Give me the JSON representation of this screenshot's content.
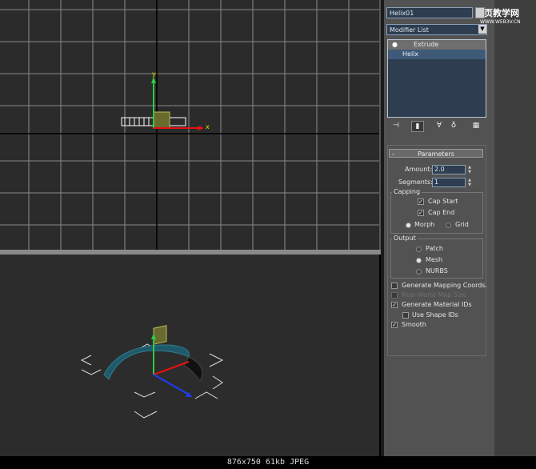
{
  "object_name": "Helix01",
  "modifier_list_label": "Modifier List",
  "stack_items": [
    "Extrude",
    "Helix"
  ],
  "parameters_title": "Parameters",
  "amount_label": "Amount:",
  "amount_value": "2.0",
  "segments_label": "Segments:",
  "segments_value": "1",
  "capping_title": "Capping",
  "cap_start_label": "Cap Start",
  "cap_end_label": "Cap End",
  "morph_label": "Morph",
  "grid_label": "Grid",
  "output_title": "Output",
  "patch_label": "Patch",
  "mesh_label": "Mesh",
  "nurbs_label": "NURBS",
  "gen_mapping_label": "Generate Mapping Coords.",
  "real_world_label": "Real-World Map Size",
  "gen_material_label": "Generate Material IDs",
  "use_shape_label": "Use Shape IDs",
  "smooth_label": "Smooth",
  "watermark_title": "网页教学网",
  "watermark_url": "WWW.WEB3V.CN",
  "axis_x": "x",
  "axis_y": "y",
  "status_text": "876x750  61kb  JPEG",
  "checkboxes": {
    "cap_start": true,
    "cap_end": true,
    "gen_mapping": false,
    "real_world": false,
    "gen_material": true,
    "use_shape": false,
    "smooth": true
  },
  "radios": {
    "capping": "Morph",
    "output": "Mesh"
  }
}
